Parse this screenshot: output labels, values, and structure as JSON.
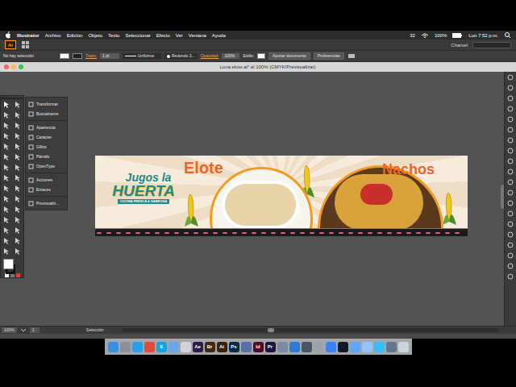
{
  "menubar": {
    "app_menu": "Illustrator",
    "items": [
      "Archivo",
      "Edición",
      "Objeto",
      "Texto",
      "Seleccionar",
      "Efecto",
      "Ver",
      "Ventana",
      "Ayuda"
    ],
    "status": {
      "number": "32",
      "battery": "100%",
      "clock": "Lun 7:52 p.m."
    }
  },
  "appbar": {
    "logo": "Ai",
    "user": "Charvel"
  },
  "control_bar": {
    "selection": "No hay selección",
    "stroke_label": "Trazo:",
    "stroke_weight": "1 pt",
    "stroke_profile": "Uniforme",
    "brush": "Redondo 3...",
    "opacity_label": "Opacidad:",
    "opacity": "100%",
    "style_label": "Estilo:",
    "buttons": [
      "Ajustar documento",
      "Preferencias"
    ]
  },
  "document": {
    "title": "Lona elote.ai* al 100% (CMYK/Previsualizar)"
  },
  "panel": {
    "groups": [
      {
        "items": [
          "Transformar",
          "Buscatrazos"
        ]
      },
      {
        "items": [
          "Apariencia",
          "Carácter",
          "Glifos",
          "Párrafo",
          "OpenType"
        ]
      },
      {
        "items": [
          "Acciones",
          "Enlaces"
        ]
      },
      {
        "items": [
          "Previsualiz..."
        ]
      }
    ]
  },
  "artwork": {
    "logo_top": "Jugos la",
    "logo_main": "HUERTA",
    "logo_tagline": "COCINA FRESCA & SABROSA",
    "title_left": "Elote",
    "title_right": "Nachos"
  },
  "status_bar": {
    "zoom": "100%",
    "artboard": "1",
    "tool": "Selección"
  },
  "dock": {
    "apps": [
      {
        "label": "",
        "color": "#3b8de0"
      },
      {
        "label": "",
        "color": "#8a8f99"
      },
      {
        "label": "",
        "color": "#2f9be8"
      },
      {
        "label": "",
        "color": "#e0493b"
      },
      {
        "label": "S",
        "color": "#1ba1e2"
      },
      {
        "label": "",
        "color": "#6aa6e8"
      },
      {
        "label": "",
        "color": "#d0d4da"
      },
      {
        "label": "Ae",
        "color": "#2a1b4a"
      },
      {
        "label": "Br",
        "color": "#3a2a14"
      },
      {
        "label": "Ai",
        "color": "#3b2209"
      },
      {
        "label": "Ps",
        "color": "#0c2a44"
      },
      {
        "label": "",
        "color": "#5a6ea8"
      },
      {
        "label": "Id",
        "color": "#4a0f2a"
      },
      {
        "label": "Pr",
        "color": "#1f1440"
      },
      {
        "label": "",
        "color": "#7a8aa0"
      },
      {
        "label": "",
        "color": "#2e7bd6"
      },
      {
        "label": "",
        "color": "#4b5563"
      },
      {
        "label": "",
        "color": "#9ca3af"
      },
      {
        "label": "",
        "color": "#3b82f6"
      },
      {
        "label": "",
        "color": "#111827"
      },
      {
        "label": "",
        "color": "#60a5fa"
      },
      {
        "label": "",
        "color": "#93c5fd"
      },
      {
        "label": "",
        "color": "#38bdf8"
      },
      {
        "label": "",
        "color": "#64748b"
      },
      {
        "label": "",
        "color": "#cbd5e1"
      }
    ]
  }
}
